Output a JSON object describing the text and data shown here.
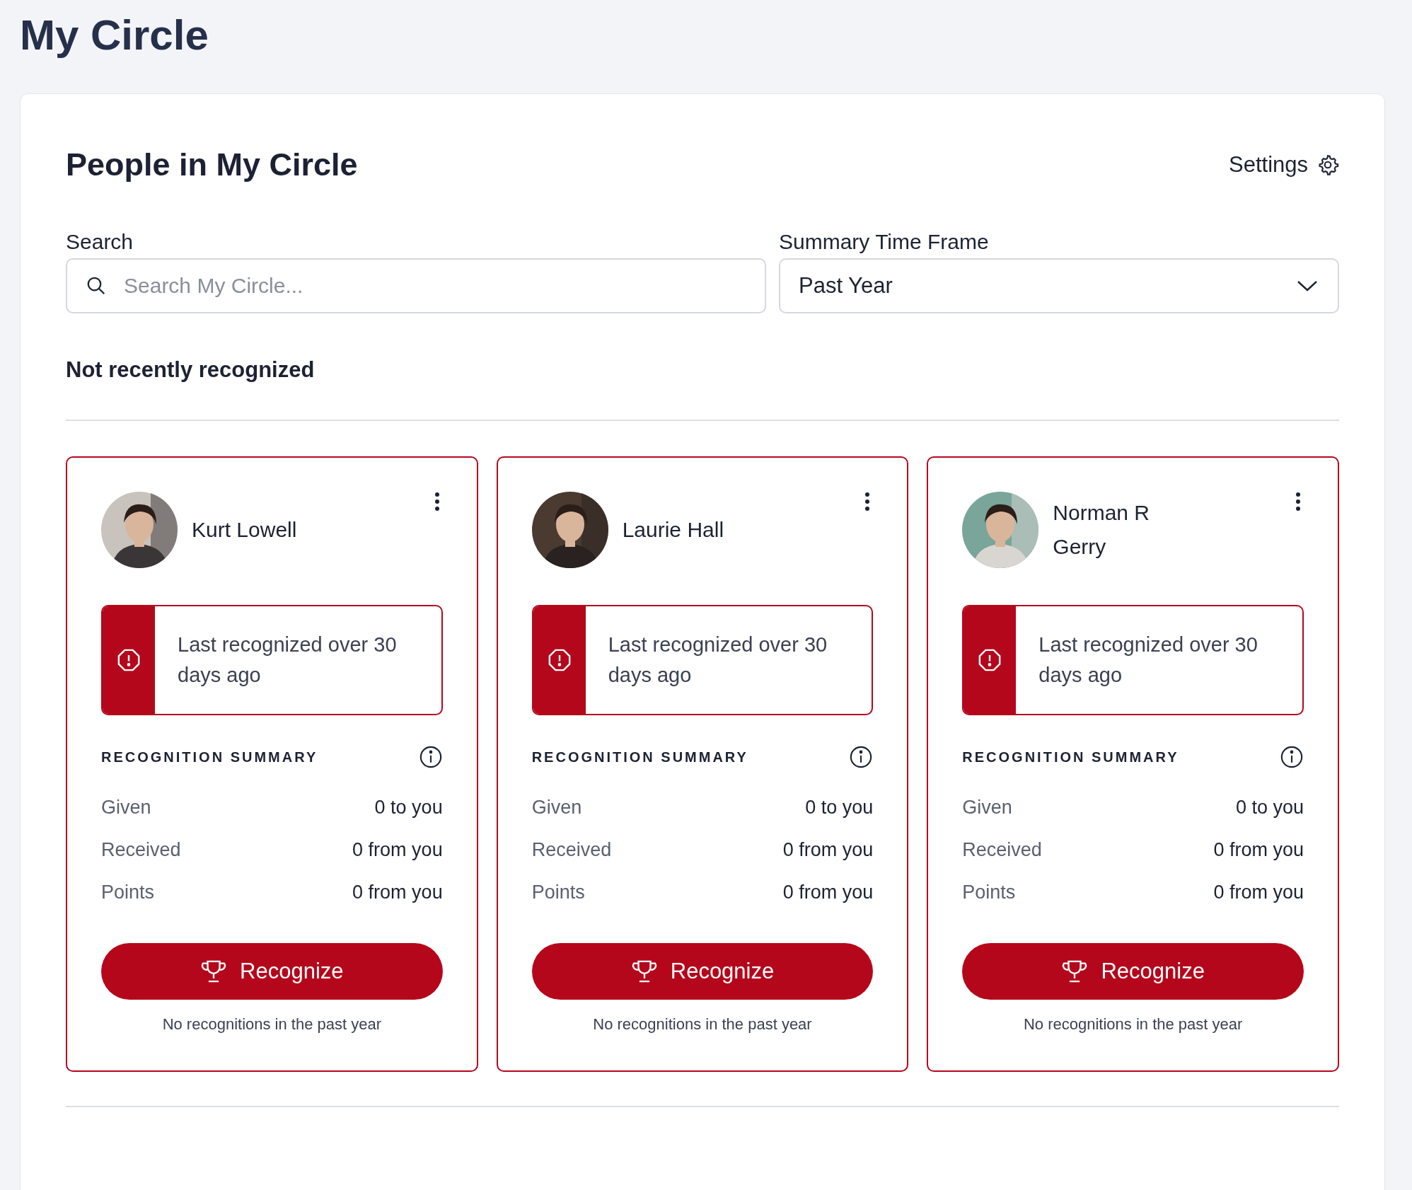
{
  "page_title": "My Circle",
  "panel": {
    "title": "People in My Circle",
    "settings_label": "Settings",
    "search": {
      "label": "Search",
      "placeholder": "Search My Circle..."
    },
    "time_frame": {
      "label": "Summary Time Frame",
      "value": "Past Year"
    },
    "section_title": "Not recently recognized",
    "cards": [
      {
        "name": "Kurt Lowell",
        "alert": "Last recognized over 30 days ago",
        "summary_title": "RECOGNITION SUMMARY",
        "rows": [
          {
            "label": "Given",
            "value": "0 to you"
          },
          {
            "label": "Received",
            "value": "0 from you"
          },
          {
            "label": "Points",
            "value": "0 from you"
          }
        ],
        "button": "Recognize",
        "footer": "No recognitions in the past year"
      },
      {
        "name": "Laurie Hall",
        "alert": "Last recognized over 30 days ago",
        "summary_title": "RECOGNITION SUMMARY",
        "rows": [
          {
            "label": "Given",
            "value": "0 to you"
          },
          {
            "label": "Received",
            "value": "0 from you"
          },
          {
            "label": "Points",
            "value": "0 from you"
          }
        ],
        "button": "Recognize",
        "footer": "No recognitions in the past year"
      },
      {
        "name": "Norman R Gerry",
        "alert": "Last recognized over 30 days ago",
        "summary_title": "RECOGNITION SUMMARY",
        "rows": [
          {
            "label": "Given",
            "value": "0 to you"
          },
          {
            "label": "Received",
            "value": "0 from you"
          },
          {
            "label": "Points",
            "value": "0 from you"
          }
        ],
        "button": "Recognize",
        "footer": "No recognitions in the past year"
      }
    ]
  }
}
